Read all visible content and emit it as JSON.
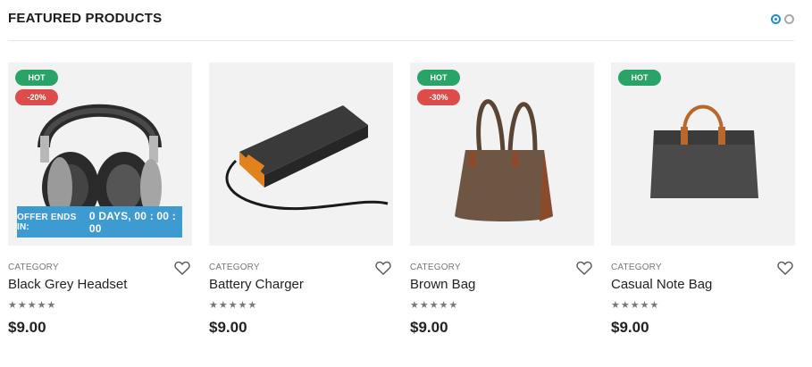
{
  "section": {
    "title": "FEATURED PRODUCTS"
  },
  "pager": {
    "dots": 2,
    "active": 1
  },
  "products": [
    {
      "category": "CATEGORY",
      "name": "Black Grey Headset",
      "price": "$9.00",
      "rating": 5,
      "stars": "★★★★★",
      "badges": {
        "hot": "HOT",
        "discount": "-20%"
      },
      "offer": {
        "prefix": "OFFER ENDS IN:",
        "countdown": "0 DAYS, 00 : 00 : 00"
      }
    },
    {
      "category": "CATEGORY",
      "name": "Battery Charger",
      "price": "$9.00",
      "rating": 5,
      "stars": "★★★★★"
    },
    {
      "category": "CATEGORY",
      "name": "Brown Bag",
      "price": "$9.00",
      "rating": 5,
      "stars": "★★★★★",
      "badges": {
        "hot": "HOT",
        "discount": "-30%"
      }
    },
    {
      "category": "CATEGORY",
      "name": "Casual Note Bag",
      "price": "$9.00",
      "rating": 5,
      "stars": "★★★★★",
      "badges": {
        "hot": "HOT"
      }
    }
  ],
  "colors": {
    "hot": "#2aa466",
    "discount": "#de4b4b",
    "offer": "#3d9bd1",
    "pager_active": "#1f8fc9"
  },
  "icons": {
    "wishlist": "heart-icon",
    "rating": "star-icon"
  }
}
